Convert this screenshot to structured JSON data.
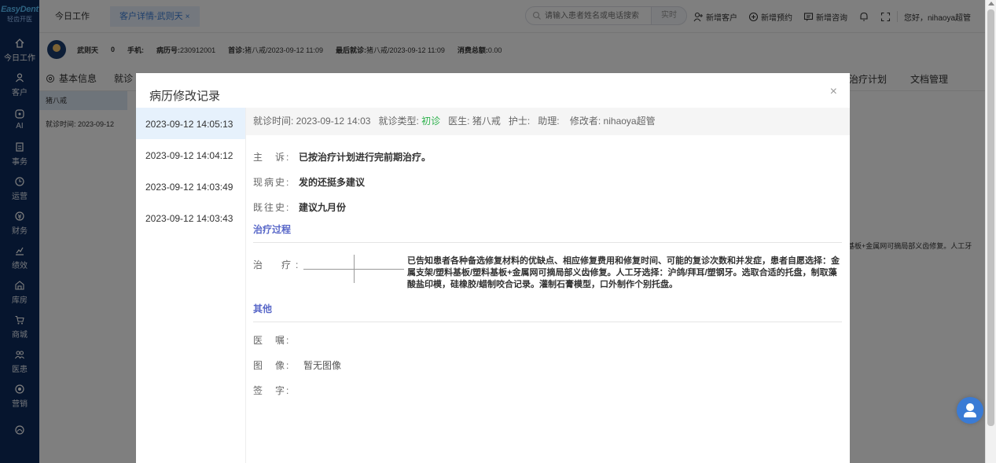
{
  "brand": {
    "name": "EasyDent",
    "sub": "轻齿开医"
  },
  "nav": [
    {
      "label": "今日工作",
      "icon": "home-icon"
    },
    {
      "label": "客户",
      "icon": "person-icon"
    },
    {
      "label": "AI",
      "icon": "ai-icon"
    },
    {
      "label": "事务",
      "icon": "task-icon"
    },
    {
      "label": "运营",
      "icon": "clock-icon"
    },
    {
      "label": "财务",
      "icon": "finance-icon"
    },
    {
      "label": "绩效",
      "icon": "chart-icon"
    },
    {
      "label": "库房",
      "icon": "warehouse-icon"
    },
    {
      "label": "商城",
      "icon": "cart-icon"
    },
    {
      "label": "医患",
      "icon": "people-icon"
    },
    {
      "label": "营销",
      "icon": "marketing-icon"
    },
    {
      "label": "",
      "icon": "more-icon"
    }
  ],
  "tabs": {
    "home": "今日工作",
    "detail": "客户详情-武则天",
    "close": "×"
  },
  "search": {
    "placeholder": "请输入患者姓名或电话搜索",
    "button": "实时"
  },
  "actions": {
    "new_customer": "新增客户",
    "new_appointment": "新增预约",
    "new_consult": "新增咨询"
  },
  "greeting": "您好，nihaoya超管",
  "patient": {
    "name": "武则天",
    "age": "0",
    "phone_label": "手机:",
    "record_label": "病历号:",
    "record_no": "230912001",
    "first_label": "首诊:",
    "first_visit": "猪八戒/2023-09-12 11:09",
    "last_label": "最后就诊:",
    "last_visit": "猪八戒/2023-09-12 11:09",
    "spend_label": "消费总额:",
    "spend": "0.00"
  },
  "bg": {
    "tab_basic": "基本信息",
    "tab_visit": "就诊",
    "tab_plan": "治疗计划",
    "tab_docs": "文档管理",
    "doctor": "猪八戒",
    "visit_time": "就诊时间: 2023-09-12",
    "right_text": "基板+金属网可摘局部义齿修复。人工牙"
  },
  "dialog": {
    "title": "病历修改记录",
    "close": "×",
    "versions": [
      "2023-09-12 14:05:13",
      "2023-09-12 14:04:12",
      "2023-09-12 14:03:49",
      "2023-09-12 14:03:43"
    ],
    "head": {
      "visit_time": "就诊时间: 2023-09-12 14:03",
      "visit_type_label": "就诊类型:",
      "visit_type": "初诊",
      "doctor": "医生: 猪八戒",
      "nurse": "护士:",
      "assistant": "助理:",
      "modifier": "修改者: nihaoya超管"
    },
    "fields": {
      "complaint_label": "主　诉:",
      "complaint": "已按治疗计划进行完前期治疗。",
      "present_label": "现病史:",
      "present": "发的还挺多建议",
      "past_label": "既往史:",
      "past": "建议九月份",
      "section_treat": "治疗过程",
      "treat_label": "治　疗:",
      "treat": "已告知患者各种备选修复材料的优缺点、相应修复费用和修复时间、可能的复诊次数和并发症，患者自愿选择：金属支架/塑料基板/塑料基板+金属网可摘局部义齿修复。人工牙选择：沪鸽/拜耳/塑钢牙。选取合适的托盘，制取藻酸盐印模，硅橡胶/蜡制咬合记录。灌制石膏模型，口外制作个别托盘。",
      "section_other": "其他",
      "advice_label": "医　嘱:",
      "image_label": "图　像:",
      "image": "暂无图像",
      "sign_label": "签　字:"
    }
  }
}
